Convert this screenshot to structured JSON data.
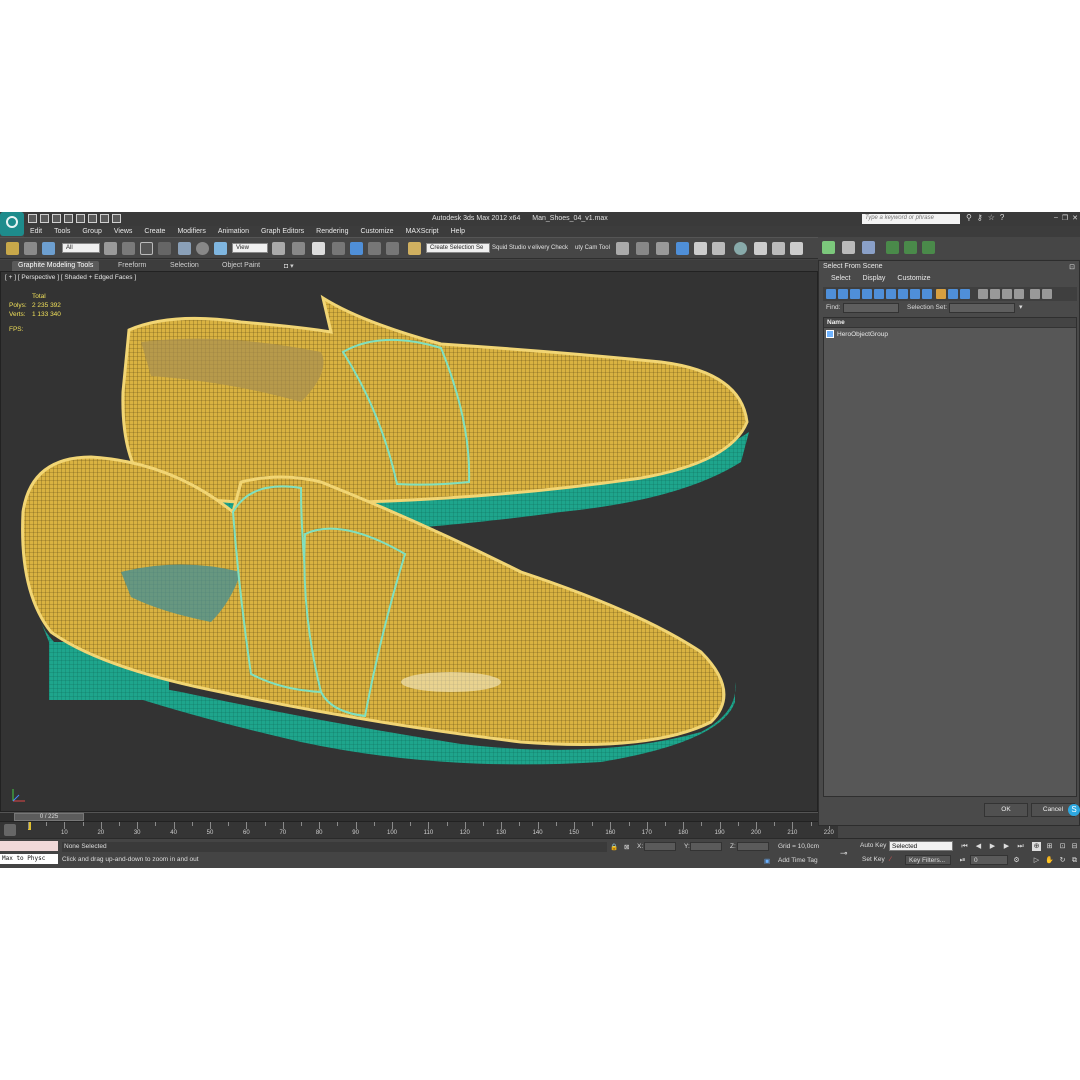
{
  "titlebar": {
    "app_title": "Autodesk 3ds Max  2012 x64",
    "file_name": "Man_Shoes_04_v1.max",
    "search_placeholder": "Type a keyword or phrase"
  },
  "menu": [
    "Edit",
    "Tools",
    "Group",
    "Views",
    "Create",
    "Modifiers",
    "Animation",
    "Graph Editors",
    "Rendering",
    "Customize",
    "MAXScript",
    "Help"
  ],
  "main_toolbar": {
    "selection_filter": "All",
    "ref_coord": "View",
    "named_selection": "Create Selection Se",
    "plugin_text_1": "Squid Studio v",
    "plugin_text_2": "elivery Check",
    "plugin_text_3": "uty Cam Tool"
  },
  "ribbon_tabs": [
    "Graphite Modeling Tools",
    "Freeform",
    "Selection",
    "Object Paint"
  ],
  "viewport": {
    "label": "[ + ] [ Perspective ] [ Shaded + Edged Faces ]",
    "stats_header": "Total",
    "polys_label": "Polys:",
    "polys_value": "2 235 392",
    "verts_label": "Verts:",
    "verts_value": "1 133 340",
    "fps_label": "FPS:",
    "wire_color": "#e8c24a",
    "sole_color": "#1ea58c",
    "bg_color": "#333333"
  },
  "timeline": {
    "position": "0 / 225",
    "ticks": [
      "10",
      "20",
      "30",
      "40",
      "50",
      "60",
      "70",
      "80",
      "90",
      "100",
      "110",
      "120",
      "130",
      "140",
      "150",
      "160",
      "170",
      "180",
      "190",
      "200",
      "210",
      "220"
    ]
  },
  "status": {
    "maxscript": "Max to Physc",
    "selection": "None Selected",
    "prompt": "Click and drag up-and-down to zoom in and out",
    "x_label": "X:",
    "y_label": "Y:",
    "z_label": "Z:",
    "grid": "Grid = 10,0cm",
    "add_time_tag": "Add Time Tag",
    "auto_key": "Auto Key",
    "set_key": "Set Key",
    "key_mode": "Selected",
    "key_filters": "Key Filters...",
    "frame": "0"
  },
  "dialog": {
    "title": "Select From Scene",
    "menu": [
      "Select",
      "Display",
      "Customize"
    ],
    "find_label": "Find:",
    "selection_set_label": "Selection Set:",
    "column_name": "Name",
    "items": [
      "HeroObjectGroup"
    ],
    "ok": "OK",
    "cancel": "Cancel"
  }
}
